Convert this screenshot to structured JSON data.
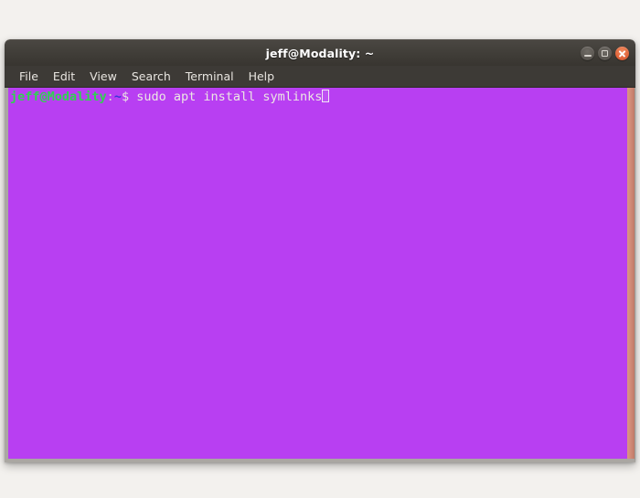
{
  "window": {
    "title": "jeff@Modality: ~",
    "controls": {
      "minimize_label": "Minimize",
      "maximize_label": "Maximize",
      "close_label": "Close"
    }
  },
  "menu": {
    "items": [
      {
        "label": "File"
      },
      {
        "label": "Edit"
      },
      {
        "label": "View"
      },
      {
        "label": "Search"
      },
      {
        "label": "Terminal"
      },
      {
        "label": "Help"
      }
    ]
  },
  "terminal": {
    "background_color": "#b83ff2",
    "prompt": {
      "user_host": "jeff@Modality",
      "separator": ":",
      "path": "~",
      "sigil": "$",
      "command": " sudo apt install symlinks"
    },
    "cursor": {
      "style": "hollow-block",
      "visible": true
    }
  },
  "colors": {
    "desktop_background": "#f3f1ee",
    "titlebar": "#403d38",
    "menubar": "#3d3a36",
    "terminal_bg": "#b83ff2",
    "prompt_green": "#2fd34f",
    "prompt_path_blue": "#3636d6",
    "text_light": "#ece7e3",
    "close_button": "#e2663c",
    "scrollbar": "#d08a77"
  }
}
